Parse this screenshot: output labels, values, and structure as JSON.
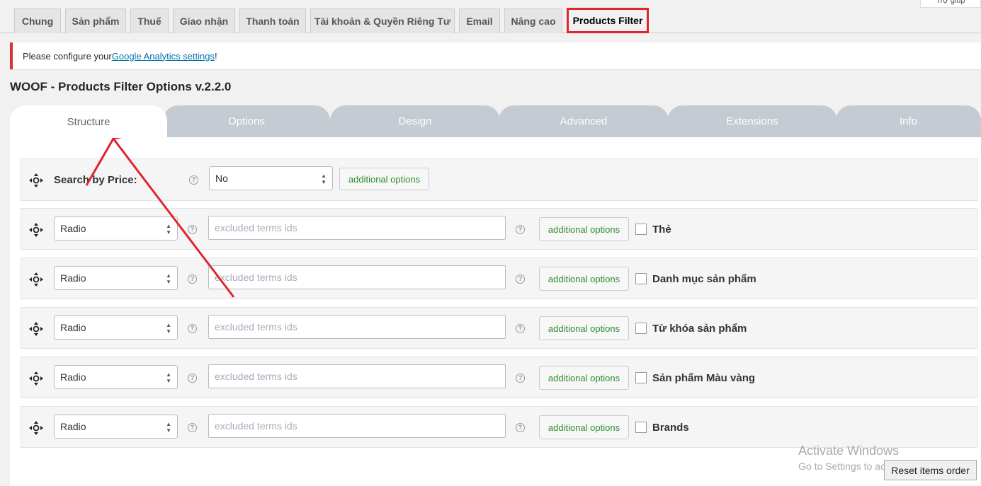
{
  "top_tabs": [
    {
      "label": "Chung"
    },
    {
      "label": "Sản phẩm"
    },
    {
      "label": "Thuế"
    },
    {
      "label": "Giao nhận"
    },
    {
      "label": "Thanh toán"
    },
    {
      "label": "Tài khoản & Quyền Riêng Tư"
    },
    {
      "label": "Email"
    },
    {
      "label": "Nâng cao"
    },
    {
      "label": "Products Filter"
    }
  ],
  "help_tab": {
    "label": "Trợ giúp"
  },
  "notice": {
    "prefix": "Please configure your ",
    "link": "Google Analytics settings",
    "suffix": "!"
  },
  "page_title": "WOOF - Products Filter Options v.2.2.0",
  "plugin_tabs": [
    {
      "label": "Structure"
    },
    {
      "label": "Options"
    },
    {
      "label": "Design"
    },
    {
      "label": "Advanced"
    },
    {
      "label": "Extensions"
    },
    {
      "label": "Info"
    }
  ],
  "price_row": {
    "label": "Search by Price:",
    "select_value": "No",
    "button": "additional options"
  },
  "rows": [
    {
      "select_value": "Radio",
      "placeholder": "excluded terms ids",
      "button": "additional options",
      "label": "Thẻ"
    },
    {
      "select_value": "Radio",
      "placeholder": "excluded terms ids",
      "button": "additional options",
      "label": "Danh mục sản phẩm"
    },
    {
      "select_value": "Radio",
      "placeholder": "excluded terms ids",
      "button": "additional options",
      "label": "Từ khóa sản phẩm"
    },
    {
      "select_value": "Radio",
      "placeholder": "excluded terms ids",
      "button": "additional options",
      "label": "Sản phẩm Màu vàng"
    },
    {
      "select_value": "Radio",
      "placeholder": "excluded terms ids",
      "button": "additional options",
      "label": "Brands"
    }
  ],
  "reset_button": "Reset items order",
  "watermark": {
    "line1": "Activate Windows",
    "line2": "Go to Settings to activate Windows."
  },
  "colors": {
    "highlight": "#e0262d",
    "tab_inactive": "#c5cbd2",
    "button_text": "#2e8b2e",
    "notice_border": "#dc3232"
  }
}
